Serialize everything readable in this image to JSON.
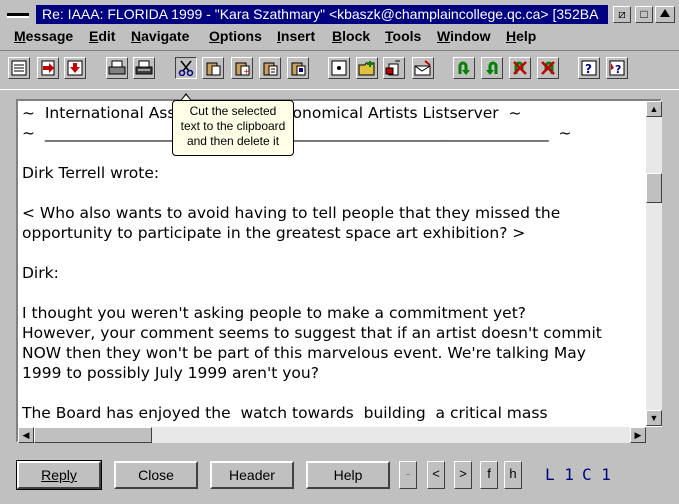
{
  "window": {
    "title": "Re: IAAA: FLORIDA 1999 - \"Kara Szathmary\" <kbaszk@champlaincollege.qc.ca> [352BA",
    "minimize_glyph": "⧄",
    "maximize_glyph": "□"
  },
  "menu": [
    "Message",
    "Edit",
    "Navigate",
    "Options",
    "Insert",
    "Block",
    "Tools",
    "Window",
    "Help"
  ],
  "tooltip": {
    "line1": "Cut the selected",
    "line2": "text to the clipboard",
    "line3": "and then delete it"
  },
  "message": {
    "lines": [
      "~  International Association of Astronomical Artists Listserver  ~",
      "~  _________________________________________________________________  ~",
      "",
      "Dirk Terrell wrote:",
      "",
      "< Who also wants to avoid having to tell people that they missed the",
      "opportunity to participate in the greatest space art exhibition? >",
      "",
      "Dirk:",
      "",
      "I thought you weren't asking people to make a commitment yet?",
      "However, your comment seems to suggest that if an artist doesn't commit",
      "NOW then they won't be part of this marvelous event. We're talking May",
      "1999 to possibly July 1999 aren't you?",
      "",
      "The Board has enjoyed the  watch towards  building  a critical mass"
    ]
  },
  "buttons": {
    "reply": "Reply",
    "close": "Close",
    "header": "Header",
    "help": "Help"
  },
  "nav": {
    "dash": "-",
    "prev": "<",
    "next": ">",
    "f": "f",
    "h": "h"
  },
  "status": {
    "line": "L 1",
    "col": "C 1"
  }
}
